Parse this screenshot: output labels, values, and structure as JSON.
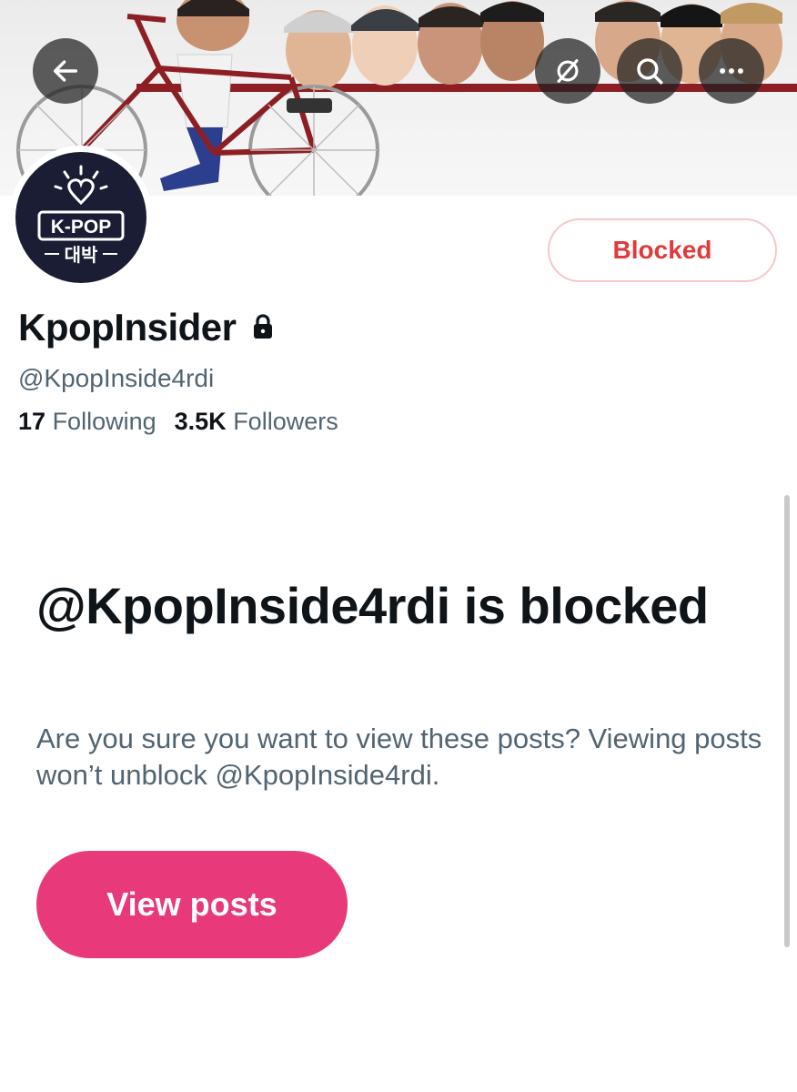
{
  "header": {
    "back_icon": "arrow-left-icon",
    "feed_icon": "feed-off-icon",
    "search_icon": "search-icon",
    "more_icon": "more-horizontal-icon"
  },
  "profile": {
    "avatar_text_top": "K-POP",
    "avatar_text_bottom": "대박",
    "display_name": "KpopInsider",
    "protected_icon": "lock-icon",
    "handle": "@KpopInside4rdi",
    "following_count": "17",
    "following_label": "Following",
    "followers_count": "3.5K",
    "followers_label": "Followers",
    "blocked_button_label": "Blocked"
  },
  "blocked_notice": {
    "title": "@KpopInside4rdi is blocked",
    "description": "Are you sure you want to view these posts? Viewing posts won’t unblock @KpopInside4rdi.",
    "view_posts_label": "View posts"
  },
  "colors": {
    "accent_pink": "#e8397b",
    "blocked_red": "#e13a3a",
    "text_primary": "#0f1419",
    "text_secondary": "#536471"
  }
}
